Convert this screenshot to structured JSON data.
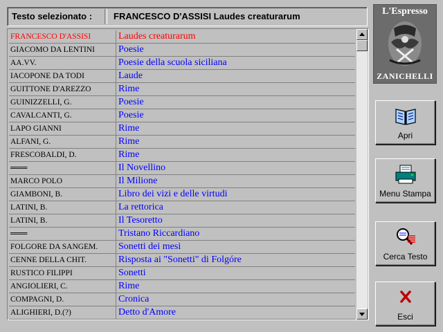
{
  "header": {
    "label": "Testo selezionato :",
    "value": "FRANCESCO D'ASSISI  Laudes creaturarum"
  },
  "list": {
    "rows": [
      {
        "author": "FRANCESCO D'ASSISI",
        "title": "Laudes creaturarum",
        "selected": true
      },
      {
        "author": "GIACOMO DA LENTINI",
        "title": "Poesie"
      },
      {
        "author": "AA.VV.",
        "title": "Poesie della scuola siciliana"
      },
      {
        "author": "IACOPONE DA TODI",
        "title": "Laude"
      },
      {
        "author": "GUITTONE D'AREZZO",
        "title": "Rime"
      },
      {
        "author": "GUINIZZELLI, G.",
        "title": "Poesie"
      },
      {
        "author": "CAVALCANTI, G.",
        "title": "Poesie"
      },
      {
        "author": "LAPO GIANNI",
        "title": "Rime"
      },
      {
        "author": "ALFANI, G.",
        "title": "Rime"
      },
      {
        "author": "FRESCOBALDI, D.",
        "title": "Rime"
      },
      {
        "author": "═══",
        "title": "Il Novellino"
      },
      {
        "author": "MARCO POLO",
        "title": "Il Milione"
      },
      {
        "author": "GIAMBONI, B.",
        "title": "Libro dei vizi e delle virtudi"
      },
      {
        "author": "LATINI, B.",
        "title": "La rettorica"
      },
      {
        "author": "LATINI, B.",
        "title": "Il Tesoretto"
      },
      {
        "author": "═══",
        "title": "Tristano Riccardiano"
      },
      {
        "author": "FOLGORE DA SANGEM.",
        "title": "Sonetti dei mesi"
      },
      {
        "author": "CENNE DELLA CHIT.",
        "title": "Risposta ai \"Sonetti\" di Folgóre"
      },
      {
        "author": "RUSTICO FILIPPI",
        "title": "Sonetti"
      },
      {
        "author": "ANGIOLIERI, C.",
        "title": "Rime"
      },
      {
        "author": "COMPAGNI, D.",
        "title": "Cronica"
      },
      {
        "author": "ALIGHIERI, D.(?)",
        "title": "Detto d'Amore"
      }
    ],
    "scroll_up_icon": "arrow-up-icon",
    "scroll_down_icon": "arrow-down-icon"
  },
  "logo": {
    "brand": "L'Espresso",
    "publisher": "ZANICHELLI"
  },
  "buttons": {
    "open": {
      "label": "Apri",
      "icon": "book-icon"
    },
    "print": {
      "label": "Menu Stampa",
      "icon": "printer-icon"
    },
    "search": {
      "label": "Cerca Testo",
      "icon": "magnifier-icon"
    },
    "exit": {
      "label": "Esci",
      "icon": "close-x-icon"
    }
  },
  "colors": {
    "selected": "#ff0000",
    "title": "#0000ff",
    "background": "#c0c0c0"
  }
}
